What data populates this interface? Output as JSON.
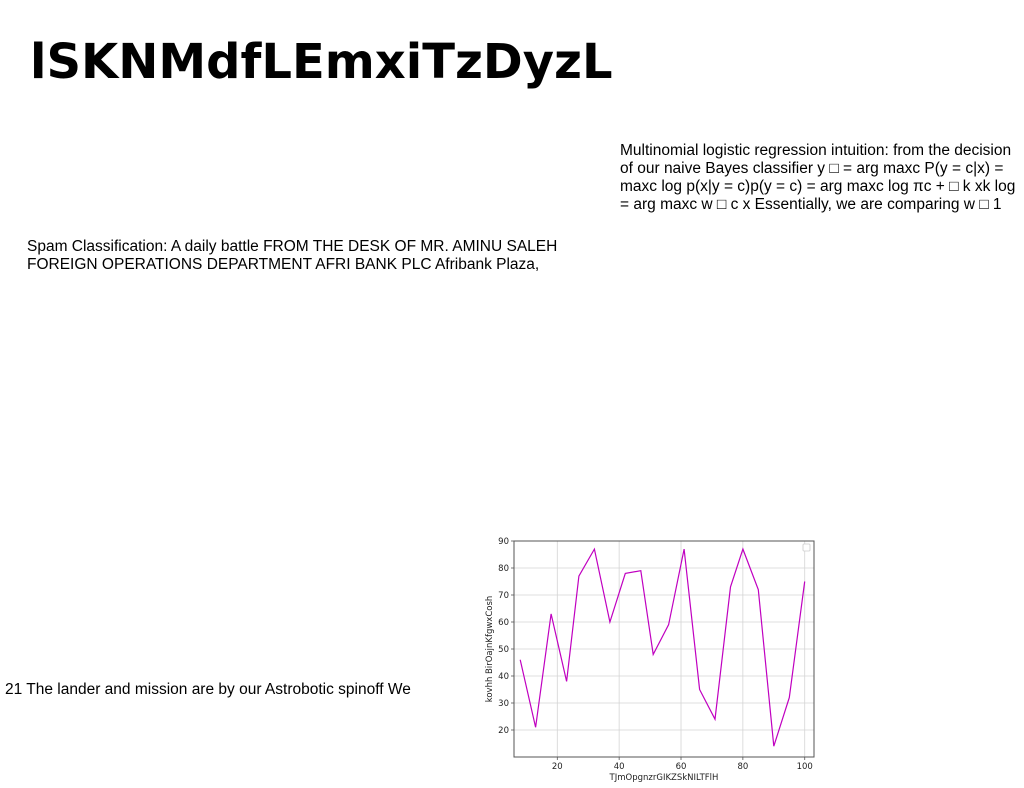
{
  "slide": {
    "title": "lSKNMdfLEmxiTzDyzL"
  },
  "blocks": {
    "multinomial": "Multinomial logistic regression intuition: from the decision\nof our naive Bayes classifier y □ = arg maxc P(y = c|x) =\nmaxc log p(x|y = c)p(y = c) = arg maxc log πc + □ k xk log\n= arg maxc w □ c x Essentially, we are comparing w □ 1",
    "spam": "Spam Classification: A daily battle FROM THE DESK OF MR. AMINU SALEH\nFOREIGN OPERATIONS DEPARTMENT AFRI BANK PLC Afribank Plaza,",
    "lander": "21 The lander and mission are by our Astrobotic spinoff We"
  },
  "chart_data": {
    "type": "line",
    "xlabel": "TJmOpgnzrGIKZSkNILTFlH",
    "ylabel": "kovhh BirOajnKfgwxCosh",
    "xlim": [
      6,
      103
    ],
    "ylim": [
      10,
      90
    ],
    "xticks": [
      20,
      40,
      60,
      80,
      100
    ],
    "yticks": [
      20,
      30,
      40,
      50,
      60,
      70,
      80,
      90
    ],
    "grid": true,
    "legend": "top-right, empty",
    "series": [
      {
        "color": "#c000c0",
        "x": [
          8,
          13,
          18,
          23,
          27,
          32,
          37,
          42,
          47,
          51,
          56,
          61,
          66,
          71,
          76,
          80,
          85,
          90,
          95,
          100
        ],
        "y": [
          46,
          21,
          63,
          38,
          77,
          87,
          60,
          78,
          79,
          48,
          59,
          87,
          35,
          24,
          73,
          87,
          72,
          14,
          32,
          75
        ]
      }
    ]
  }
}
